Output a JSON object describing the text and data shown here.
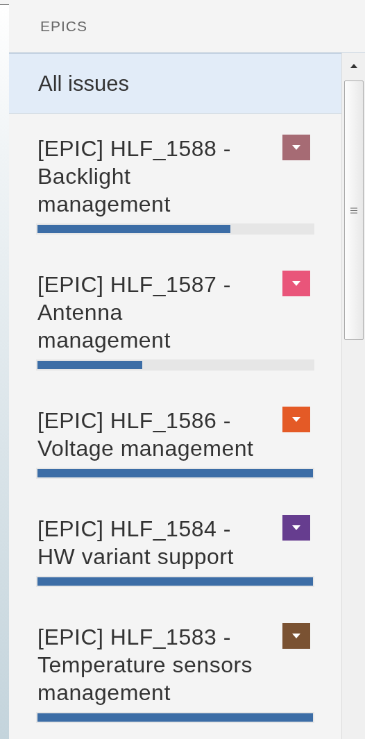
{
  "panel": {
    "title": "EPICS"
  },
  "all_issues": {
    "label": "All issues",
    "selected": true
  },
  "epics": [
    {
      "title": "[EPIC] HLF_1588 - Backlight management",
      "color": "#a66b74",
      "level": 0.7,
      "selected": false
    },
    {
      "title": "[EPIC] HLF_1587 - Antenna management",
      "color": "#e9557a",
      "level": 0.38,
      "selected": false
    },
    {
      "title": "[EPIC] HLF_1586 - Voltage management",
      "color": "#e45a26",
      "level": 1,
      "selected": false
    },
    {
      "title": "[EPIC] HLF_1584 - HW variant support",
      "color": "#663d8f",
      "level": 1,
      "selected": false
    },
    {
      "title": "[EPIC] HLF_1583 - Temperature sensors management",
      "color": "#7a5232",
      "level": 1,
      "selected": false
    }
  ]
}
